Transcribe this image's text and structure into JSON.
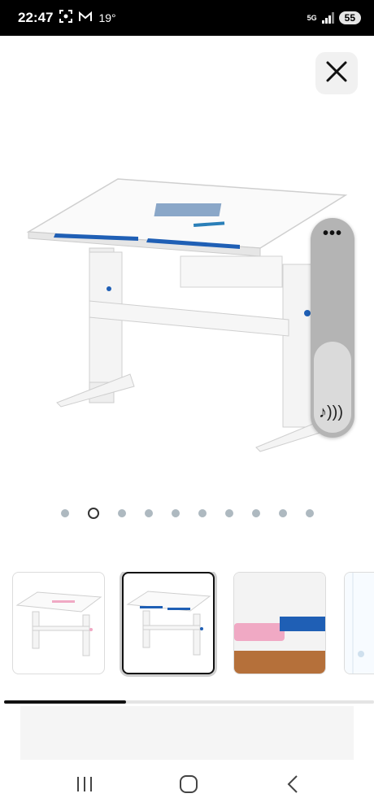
{
  "status_bar": {
    "time": "22:47",
    "temperature": "19°",
    "network": "5G",
    "battery": "55"
  },
  "icons": {
    "close": "close-icon",
    "more": "more-dots-icon",
    "music": "music-note-icon"
  },
  "floating_panel": {
    "more_label": "•••",
    "music_label": "♪)))"
  },
  "gallery": {
    "total_images": 10,
    "current_index": 2,
    "thumbnails": [
      {
        "name": "thumbnail-desk-pink",
        "selected": false
      },
      {
        "name": "thumbnail-desk-blue",
        "selected": true
      },
      {
        "name": "thumbnail-pen-ledge-closeup",
        "selected": false
      },
      {
        "name": "thumbnail-partial",
        "selected": false
      }
    ],
    "scroll_progress": 0.33
  },
  "colors": {
    "accent_blue": "#1f5fb5",
    "accent_pink": "#f0a9c4",
    "status_bar_bg": "#000000"
  }
}
